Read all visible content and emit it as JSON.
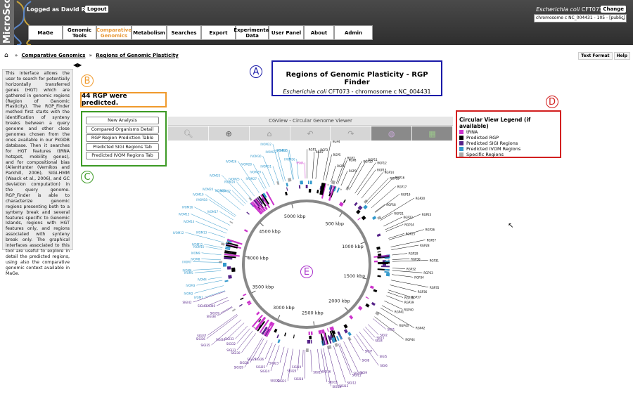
{
  "header": {
    "logo": "MicroScope",
    "user": "Logged as David ROCHE",
    "logout": "Logout",
    "organism": "Escherichia coli",
    "strain": "CFT073",
    "change": "Change",
    "replicon": "chromosome c NC_004431 - 105 - [public]"
  },
  "menu": [
    {
      "label": "MaGe"
    },
    {
      "label": "Genomic Tools"
    },
    {
      "label": "Comparative Genomics",
      "active": true
    },
    {
      "label": "Metabolism"
    },
    {
      "label": "Searches"
    },
    {
      "label": "Export"
    },
    {
      "label": "Experimental Data"
    },
    {
      "label": "User Panel"
    },
    {
      "label": "About"
    },
    {
      "label": "Admin"
    }
  ],
  "breadcrumb": {
    "sep": "»",
    "items": [
      "Comparative Genomics",
      "Regions of Genomic Plasticity"
    ]
  },
  "topright": {
    "text_format": "Text Format",
    "help": "Help"
  },
  "description": "This interface allows the user to search for potentially horizontally transferred genes (HGT) which are gathered in genomic regions (Region of Genomic Plasticity). The RGP_Finder method first starts with the identification of synteny breaks between a query genome and other close genomes chosen from the ones available in our PkGDB database. Then it searches for HGT features (tRNA hotspot, mobility genes), and for compositional bias (AlienHunter (Vernikos and Parkhill, 2006), SIGI-HMM (Waack et al., 2006), and GC deviation computation) in the query genome. RGP_Finder is able to characterize genomic regions presenting both to a synteny break and several features specific to Genomic Islands, regions with HGT features only, and regions associated with synteny break only. The graphical interfaces associated to this tool are useful to explore in detail the predicted regions, using also the comparative genomic context available in MaGe.",
  "labels": {
    "a": "A",
    "b": "B",
    "c": "C",
    "d": "D",
    "e": "E"
  },
  "title": {
    "main": "Regions of Genomic Plasticity - RGP Finder",
    "organism": "Escherichia coli",
    "rest": "CFT073 - chromosome c NC_004431"
  },
  "rgp_count_text": "44 RGP were predicted.",
  "buttons": [
    "New Analysis",
    "Compared Organisms Detail",
    "RGP Region Prediction Table",
    "Predicted SIGI Regions Tab",
    "Predicted IVOM Regions Tab"
  ],
  "legend": {
    "title": "Circular View Legend (if available)",
    "items": [
      {
        "label": "tRNA",
        "color": "#cc33cc"
      },
      {
        "label": "Predicted RGP",
        "color": "#000000"
      },
      {
        "label": "Predicted SIGI Regions",
        "color": "#552288"
      },
      {
        "label": "Predicted IVOM Regions",
        "color": "#3399cc"
      },
      {
        "label": "Specific Regions",
        "color": "#aaaaaa"
      }
    ]
  },
  "viewer": {
    "title": "CGView - Circular Genome Viewer",
    "tools": [
      "zoom-out-icon",
      "zoom-in-icon",
      "home-icon",
      "undo-icon",
      "redo-icon",
      "circle-view-icon",
      "linear-view-icon"
    ],
    "ticks": [
      "500 kbp",
      "1000 kbp",
      "1500 kbp",
      "2000 kbp",
      "2500 kbp",
      "3000 kbp",
      "3500 kbp",
      "4000 kbp",
      "4500 kbp",
      "5000 kbp"
    ]
  },
  "feature_labels": [
    "RGP1",
    "RGP2",
    "RGP3",
    "RGP4",
    "RGP5",
    "RGP6",
    "RGP7",
    "RGP8",
    "RGP9",
    "RGP10",
    "RGP11",
    "RGP12",
    "RGP13",
    "RGP14",
    "RGP15",
    "RGP16",
    "RGP17",
    "RGP18",
    "RGP19",
    "RGP20",
    "RGP21",
    "RGP22",
    "RGP23",
    "RGP24",
    "RGP25",
    "RGP26",
    "RGP27",
    "RGP28",
    "RGP29",
    "RGP30",
    "RGP31",
    "RGP32",
    "RGP33",
    "RGP34",
    "RGP35",
    "RGP36",
    "RGP37",
    "RGP38",
    "RGP39",
    "RGP40",
    "RGP41",
    "RGP42",
    "RGP43",
    "RGP44",
    "SIGI1",
    "SIGI2",
    "SIGI3",
    "SIGI4",
    "SIGI5",
    "SIGI6",
    "SIGI7",
    "SIGI8",
    "SIGI9",
    "SIGI10",
    "SIGI11",
    "SIGI12",
    "SIGI13",
    "SIGI14",
    "SIGI15",
    "SIGI16",
    "SIGI17",
    "SIGI18",
    "SIGI19",
    "SIGI20",
    "SIGI21",
    "SIGI22",
    "SIGI23",
    "SIGI24",
    "SIGI25",
    "SIGI26",
    "SIGI27",
    "SIGI28",
    "SIGI29",
    "SIGI30",
    "SIGI31",
    "SIGI32",
    "SIGI33",
    "SIGI34",
    "SIGI35",
    "SIGI36",
    "SIGI37",
    "SIGI38",
    "SIGI39",
    "SIGI40",
    "SIGI41",
    "SIGI42",
    "IVOM1",
    "IVOM2",
    "IVOM3",
    "IVOM4",
    "IVOM5",
    "IVOM6",
    "IVOM7",
    "IVOM8",
    "IVOM9",
    "IVOM10",
    "IVOM11",
    "IVOM12",
    "IVOM13",
    "IVOM14",
    "IVOM15",
    "IVOM16",
    "IVOM17",
    "IVOM18",
    "IVOM19",
    "IVOM20",
    "IVOM21",
    "IVOM22",
    "IVOM23",
    "IVOM24",
    "IVOM25",
    "IVOM26",
    "IVOM27",
    "IVOM28",
    "IVOM29",
    "IVOM30",
    "IVOM31",
    "IVOM32",
    "IVOM33",
    "IVOM34",
    "IVOM35",
    "IVOM36",
    "tRNA"
  ]
}
